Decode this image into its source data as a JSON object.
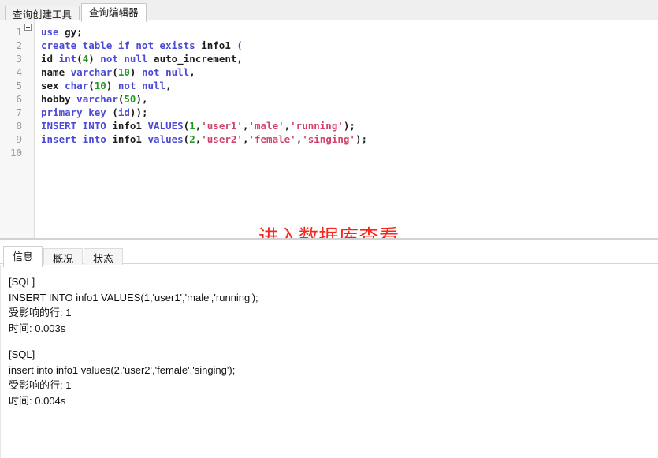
{
  "top_tabs": [
    {
      "label": "查询创建工具",
      "active": false
    },
    {
      "label": "查询编辑器",
      "active": true
    }
  ],
  "editor": {
    "lines": [
      {
        "number": "1",
        "tokens": [
          {
            "t": "use",
            "c": "kw"
          },
          {
            "t": " ",
            "c": "pun"
          },
          {
            "t": "gy",
            "c": "id"
          },
          {
            "t": ";",
            "c": "pun"
          }
        ]
      },
      {
        "number": "2",
        "tokens": [
          {
            "t": "create table if not exists ",
            "c": "kw"
          },
          {
            "t": "info1",
            "c": "id"
          },
          {
            "t": " ",
            "c": "pun"
          },
          {
            "t": "(",
            "c": "kw"
          }
        ]
      },
      {
        "number": "3",
        "tokens": [
          {
            "t": "id",
            "c": "id"
          },
          {
            "t": " ",
            "c": "pun"
          },
          {
            "t": "int",
            "c": "kw"
          },
          {
            "t": "(",
            "c": "pun"
          },
          {
            "t": "4",
            "c": "num"
          },
          {
            "t": ")",
            "c": "pun"
          },
          {
            "t": " ",
            "c": "pun"
          },
          {
            "t": "not null",
            "c": "kw"
          },
          {
            "t": " ",
            "c": "pun"
          },
          {
            "t": "auto_increment",
            "c": "id"
          },
          {
            "t": ",",
            "c": "pun"
          }
        ]
      },
      {
        "number": "4",
        "tokens": [
          {
            "t": "name",
            "c": "id"
          },
          {
            "t": " ",
            "c": "pun"
          },
          {
            "t": "varchar",
            "c": "kw"
          },
          {
            "t": "(",
            "c": "pun"
          },
          {
            "t": "10",
            "c": "num"
          },
          {
            "t": ")",
            "c": "pun"
          },
          {
            "t": " ",
            "c": "pun"
          },
          {
            "t": "not null",
            "c": "kw"
          },
          {
            "t": ",",
            "c": "pun"
          }
        ]
      },
      {
        "number": "5",
        "tokens": [
          {
            "t": "sex",
            "c": "id"
          },
          {
            "t": " ",
            "c": "pun"
          },
          {
            "t": "char",
            "c": "kw"
          },
          {
            "t": "(",
            "c": "pun"
          },
          {
            "t": "10",
            "c": "num"
          },
          {
            "t": ")",
            "c": "pun"
          },
          {
            "t": " ",
            "c": "pun"
          },
          {
            "t": "not null",
            "c": "kw"
          },
          {
            "t": ",",
            "c": "pun"
          }
        ]
      },
      {
        "number": "6",
        "tokens": [
          {
            "t": "hobby",
            "c": "id"
          },
          {
            "t": " ",
            "c": "pun"
          },
          {
            "t": "varchar",
            "c": "kw"
          },
          {
            "t": "(",
            "c": "pun"
          },
          {
            "t": "50",
            "c": "num"
          },
          {
            "t": ")",
            "c": "pun"
          },
          {
            "t": ",",
            "c": "pun"
          }
        ]
      },
      {
        "number": "7",
        "tokens": [
          {
            "t": "primary key",
            "c": "kw"
          },
          {
            "t": " ",
            "c": "pun"
          },
          {
            "t": "(",
            "c": "pun"
          },
          {
            "t": "id",
            "c": "kw"
          },
          {
            "t": "));",
            "c": "pun"
          }
        ]
      },
      {
        "number": "8",
        "tokens": [
          {
            "t": "INSERT INTO",
            "c": "kw"
          },
          {
            "t": " ",
            "c": "pun"
          },
          {
            "t": "info1",
            "c": "id"
          },
          {
            "t": " ",
            "c": "pun"
          },
          {
            "t": "VALUES",
            "c": "kw"
          },
          {
            "t": "(",
            "c": "pun"
          },
          {
            "t": "1",
            "c": "num"
          },
          {
            "t": ",",
            "c": "pun"
          },
          {
            "t": "'user1'",
            "c": "str"
          },
          {
            "t": ",",
            "c": "pun"
          },
          {
            "t": "'male'",
            "c": "str"
          },
          {
            "t": ",",
            "c": "pun"
          },
          {
            "t": "'running'",
            "c": "str"
          },
          {
            "t": ");",
            "c": "pun"
          }
        ]
      },
      {
        "number": "9",
        "tokens": [
          {
            "t": "insert into",
            "c": "kw"
          },
          {
            "t": " ",
            "c": "pun"
          },
          {
            "t": "info1",
            "c": "id"
          },
          {
            "t": " ",
            "c": "pun"
          },
          {
            "t": "values",
            "c": "kw"
          },
          {
            "t": "(",
            "c": "pun"
          },
          {
            "t": "2",
            "c": "num"
          },
          {
            "t": ",",
            "c": "pun"
          },
          {
            "t": "'user2'",
            "c": "str"
          },
          {
            "t": ",",
            "c": "pun"
          },
          {
            "t": "'female'",
            "c": "str"
          },
          {
            "t": ",",
            "c": "pun"
          },
          {
            "t": "'singing'",
            "c": "str"
          },
          {
            "t": ");",
            "c": "pun"
          }
        ]
      },
      {
        "number": "10",
        "tokens": []
      }
    ],
    "annotation": "进入数据库查看",
    "annotation_color": "#fb2418"
  },
  "bottom_tabs": [
    {
      "label": "信息",
      "active": true
    },
    {
      "label": "概况",
      "active": false
    },
    {
      "label": "状态",
      "active": false
    }
  ],
  "log": {
    "blocks": [
      {
        "header": "[SQL]",
        "statement": "INSERT INTO info1 VALUES(1,'user1','male','running');",
        "affected": "受影响的行: 1",
        "time": "时间: 0.003s"
      },
      {
        "header": "[SQL]",
        "statement": "insert into info1 values(2,'user2','female','singing');",
        "affected": "受影响的行: 1",
        "time": "时间: 0.004s"
      }
    ]
  }
}
